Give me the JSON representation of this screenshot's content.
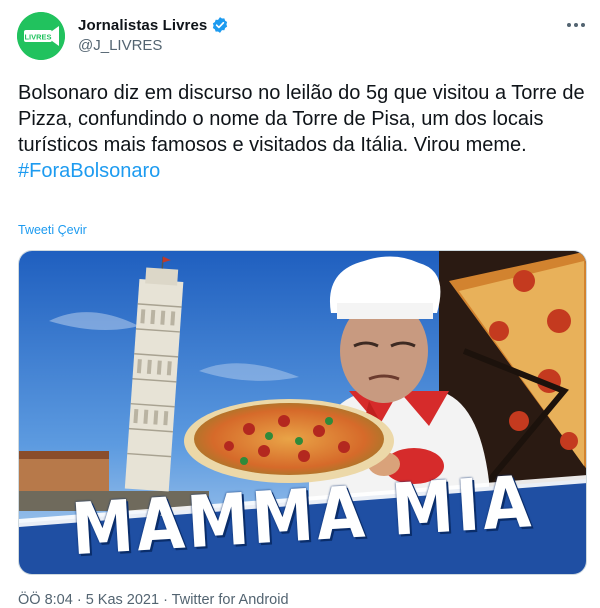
{
  "account": {
    "display_name": "Jornalistas Livres",
    "handle": "@J_LIVRES",
    "avatar_text": "LIVRES"
  },
  "tweet": {
    "text": "Bolsonaro diz em discurso no leilão do 5g que visitou a Torre de Pizza, confundindo o nome da Torre de Pisa, um dos locais  turísticos mais famosos e visitados da Itália. Virou meme.",
    "hashtag": "#ForaBolsonaro",
    "translate_label": "Tweeti Çevir"
  },
  "media": {
    "banner_text": "MAMMA MIA"
  },
  "meta": {
    "timestamp": "ÖÖ 8:04 · 5 Kas 2021 · Twitter for Android"
  },
  "colors": {
    "accent": "#1d9bf0",
    "avatar_green": "#21c25e",
    "banner_blue": "#1f4fa3"
  },
  "icons": {
    "verified": "verified-badge-icon",
    "more": "more-dots-icon"
  }
}
